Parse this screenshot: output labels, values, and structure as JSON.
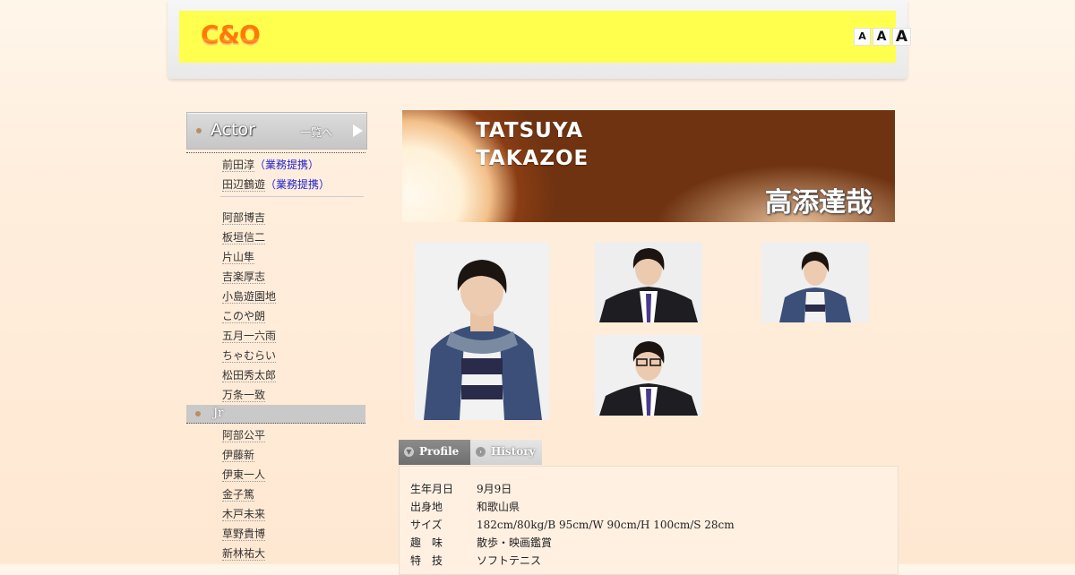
{
  "header": {
    "logo_text": "C&O",
    "font_size_buttons": [
      "A",
      "A",
      "A"
    ]
  },
  "sidebar": {
    "actor_section": {
      "title": "Actor",
      "link_label": "一覧へ"
    },
    "partner_items": [
      {
        "name": "前田淳",
        "tag": "（業務提携）"
      },
      {
        "name": "田辺鶴遊",
        "tag": "（業務提携）"
      }
    ],
    "actor_items": [
      "阿部博吉",
      "板垣信二",
      "片山隼",
      "吉楽厚志",
      "小島遊園地",
      "このや朗",
      "五月一六雨",
      "ちゃむらい",
      "松田秀太郎",
      "万条一致"
    ],
    "jr_section": {
      "title": "Jr"
    },
    "jr_items": [
      "阿部公平",
      "伊藤新",
      "伊東一人",
      "金子篤",
      "木戸未来",
      "草野貴博",
      "新林祐大"
    ]
  },
  "banner": {
    "name_en_line1": "TATSUYA",
    "name_en_line2": "TAKAZOE",
    "name_jp": "高添達哉"
  },
  "tabs": {
    "profile": "Profile",
    "history": "History"
  },
  "profile": {
    "rows": [
      {
        "label": "生年月日",
        "value": "9月9日"
      },
      {
        "label": "出身地",
        "value": "和歌山県"
      },
      {
        "label": "サイズ",
        "value": "182cm/80kg/B 95cm/W 90cm/H 100cm/S 28cm"
      },
      {
        "label": "趣　味",
        "value": "散歩・映画鑑賞"
      },
      {
        "label": "特　技",
        "value": "ソフトテニス"
      }
    ]
  },
  "colors": {
    "header_band": "#ffff4d",
    "logo": "#ff7a00",
    "banner_brown": "#6f3311",
    "link_blue": "#2222cc"
  }
}
